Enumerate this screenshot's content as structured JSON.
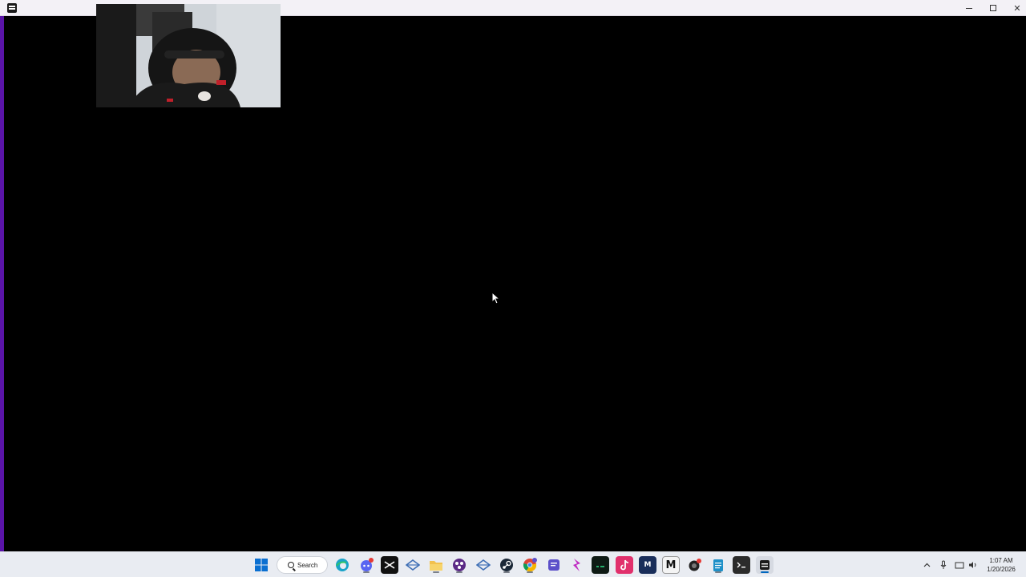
{
  "window": {
    "title": ""
  },
  "taskbar": {
    "search_label": "Search",
    "apps": [
      {
        "name": "start-button",
        "icon": "windows-logo-icon",
        "color": "#0a6fd1"
      },
      {
        "name": "edge",
        "icon": "edge-icon",
        "color": "#1aa3c9"
      },
      {
        "name": "discord",
        "icon": "discord-icon",
        "color": "#5865f2",
        "badge": "28"
      },
      {
        "name": "capcut",
        "icon": "capcut-icon",
        "color": "#111111"
      },
      {
        "name": "app-diamond-1",
        "icon": "diamond-icon",
        "color": "#3f6fb5"
      },
      {
        "name": "file-explorer",
        "icon": "folder-icon",
        "color": "#f2c14e"
      },
      {
        "name": "obs",
        "icon": "obs-icon",
        "color": "#5b2a86"
      },
      {
        "name": "app-diamond-2",
        "icon": "diamond-icon",
        "color": "#3f6fb5"
      },
      {
        "name": "steam",
        "icon": "steam-icon",
        "color": "#1b2838"
      },
      {
        "name": "chrome",
        "icon": "chrome-icon",
        "color": "#34a853"
      },
      {
        "name": "app-chat",
        "icon": "chat-icon",
        "color": "#5b4fc9"
      },
      {
        "name": "app-bolt",
        "icon": "bolt-icon",
        "color": "#c02cc2"
      },
      {
        "name": "app-terminal-green",
        "icon": "terminal-icon",
        "color": "#0e1a14"
      },
      {
        "name": "tiktok",
        "icon": "tiktok-icon",
        "color": "#e1306c"
      },
      {
        "name": "app-mx",
        "icon": "mx-icon",
        "color": "#1a2e5a"
      },
      {
        "name": "app-m",
        "icon": "m-icon",
        "color": "#f4f4f4"
      },
      {
        "name": "app-record",
        "icon": "record-icon",
        "color": "#222222"
      },
      {
        "name": "notepad",
        "icon": "notepad-icon",
        "color": "#1e90c8"
      },
      {
        "name": "terminal",
        "icon": "terminal-icon",
        "color": "#2b2b2b"
      },
      {
        "name": "app-active",
        "icon": "app-icon",
        "color": "#1a1a1a"
      }
    ],
    "clock": {
      "time": "1:07 AM",
      "date": "1/20/2026"
    }
  },
  "colors": {
    "accent": "#5a14a8",
    "taskbar_bg": "#e9ecf2"
  }
}
